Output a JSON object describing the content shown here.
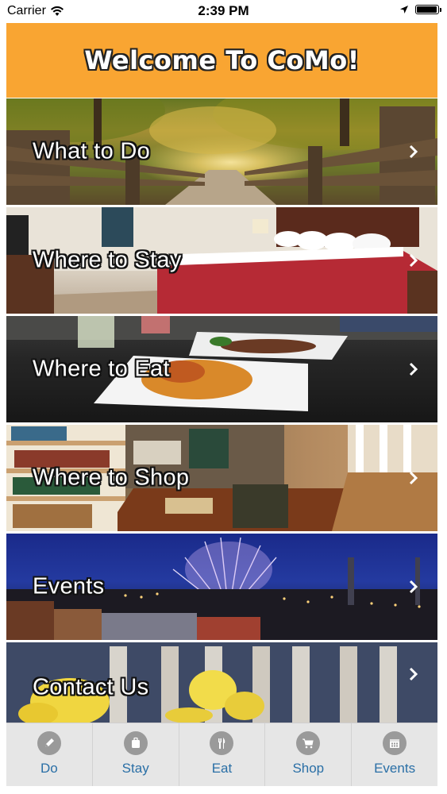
{
  "status_bar": {
    "carrier": "Carrier",
    "time": "2:39 PM",
    "battery_level": 0.95
  },
  "header": {
    "title": "Welcome To CoMo!"
  },
  "menu": {
    "items": [
      {
        "label": "What to Do"
      },
      {
        "label": "Where to Stay"
      },
      {
        "label": "Where to Eat"
      },
      {
        "label": "Where to Shop"
      },
      {
        "label": "Events"
      },
      {
        "label": "Contact Us"
      }
    ]
  },
  "tab_bar": {
    "tabs": [
      {
        "label": "Do",
        "icon": "pencil-icon"
      },
      {
        "label": "Stay",
        "icon": "suitcase-icon"
      },
      {
        "label": "Eat",
        "icon": "fork-knife-icon"
      },
      {
        "label": "Shop",
        "icon": "cart-icon"
      },
      {
        "label": "Events",
        "icon": "calendar-icon"
      }
    ]
  },
  "colors": {
    "header_bg": "#F9A532",
    "tab_bar_bg": "#E6E6E6",
    "tab_label": "#2a6fa6",
    "tab_icon": "#9a9a9a"
  }
}
